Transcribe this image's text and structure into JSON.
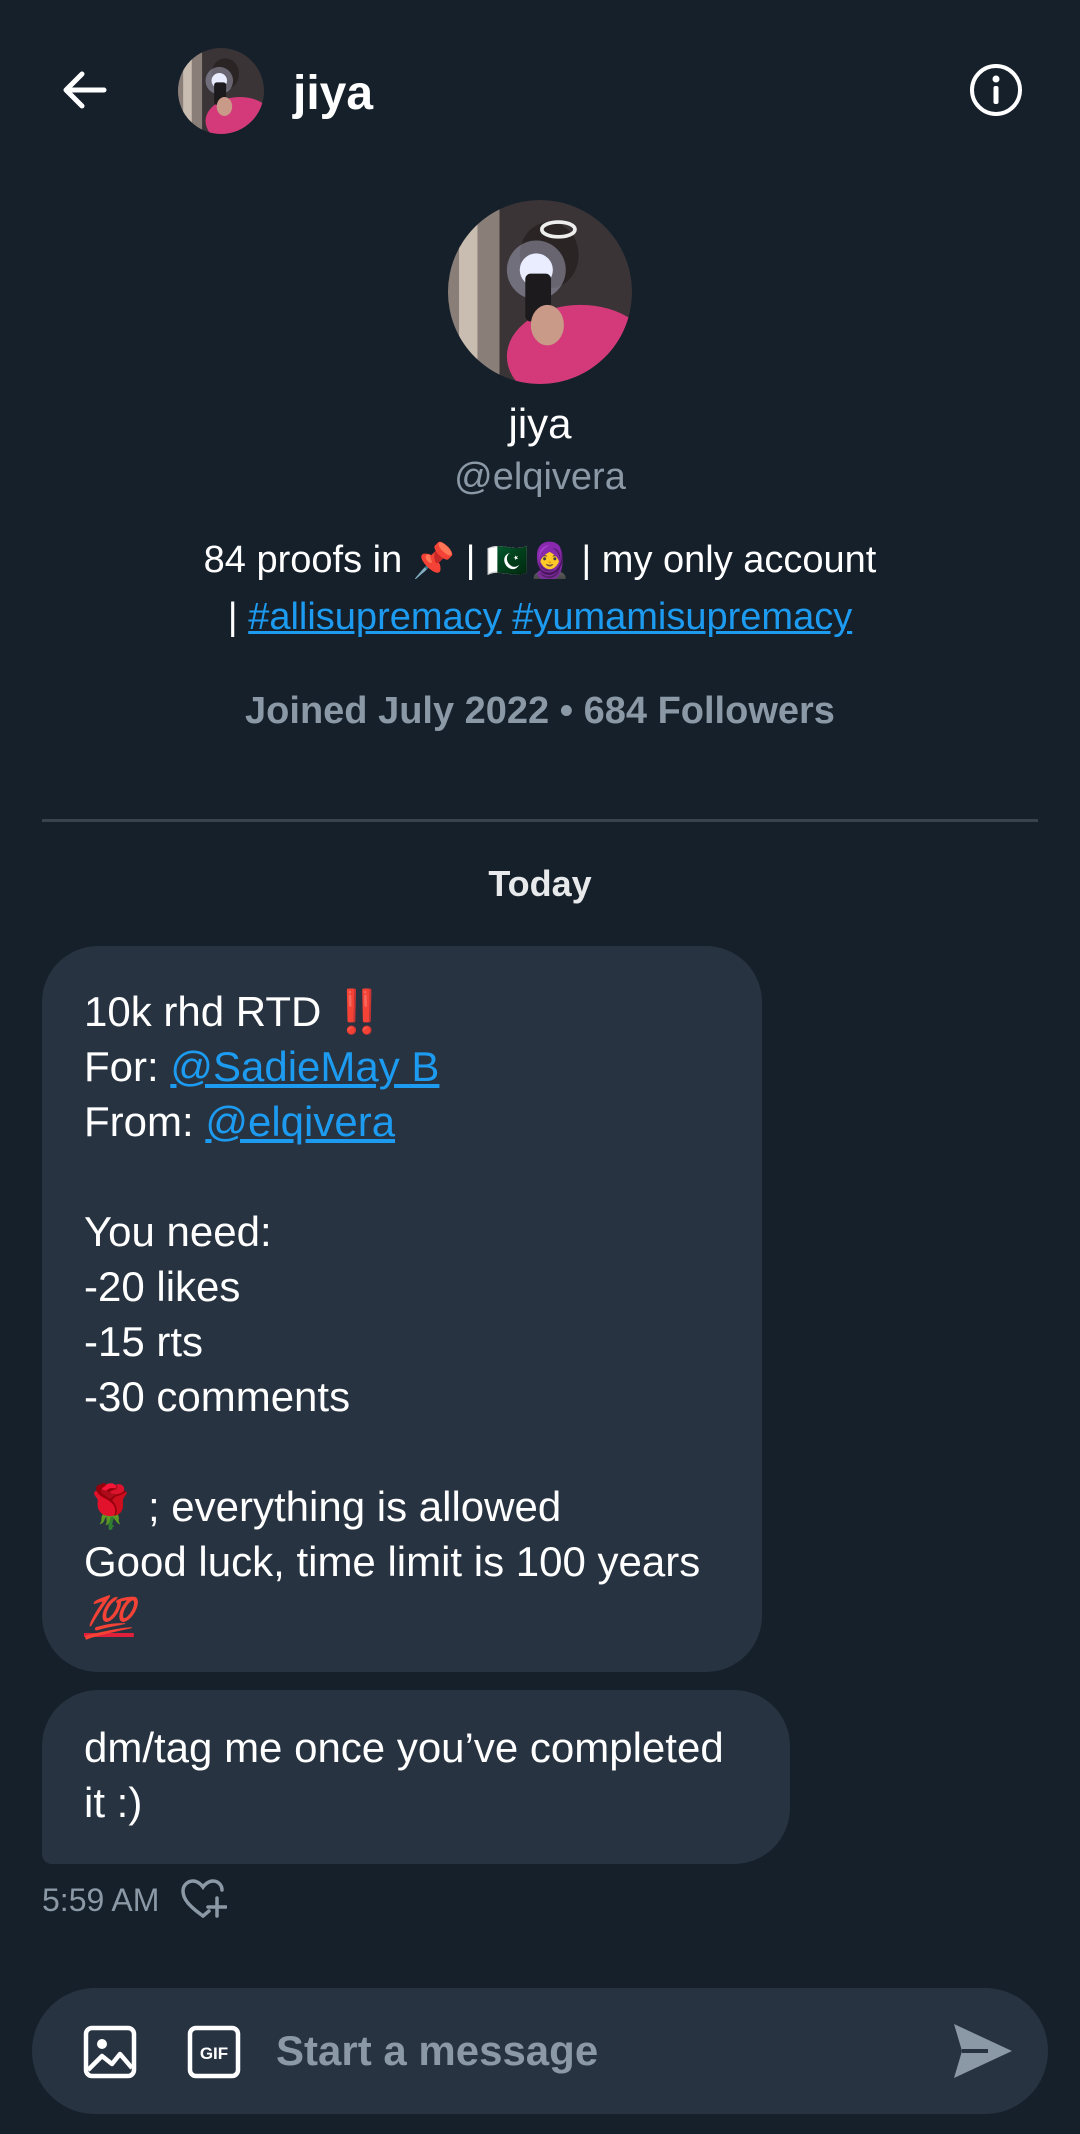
{
  "header": {
    "name": "jiya"
  },
  "profile": {
    "name": "jiya",
    "handle": "@elqivera",
    "bio_part1": "84 proofs in ",
    "bio_pin": "📌",
    "bio_sep1": " | ",
    "bio_flag": "🇵🇰",
    "bio_person": "🧕",
    "bio_part2": " | my only account",
    "bio_sep2": "| ",
    "hashtag1": "#allisupremacy",
    "hashtag2": "#yumamisupremacy",
    "joined": "Joined July 2022 • 684 Followers"
  },
  "conversation": {
    "date_label": "Today",
    "message1": {
      "line1_text": "10k rhd RTD ",
      "line1_emoji": "‼️",
      "line2_prefix": "For: ",
      "line2_mention": "@SadieMay B",
      "line3_prefix": "From: ",
      "line3_mention": "@elqivera",
      "line5": "You need:",
      "line6": "-20 likes",
      "line7": "-15 rts",
      "line8": "-30 comments",
      "line10_emoji": "🌹",
      "line10_text": " ; everything is allowed",
      "line11": "Good luck, time limit is 100 years",
      "line12_emoji": "💯"
    },
    "message2": {
      "text": "dm/tag me once you’ve completed it :)"
    },
    "timestamp": "5:59 AM"
  },
  "composer": {
    "placeholder": "Start a message",
    "gif_label": "GIF"
  },
  "colors": {
    "background": "#15202b",
    "bubble": "#273340",
    "accent": "#1d9bf0",
    "muted": "#8b98a5"
  }
}
